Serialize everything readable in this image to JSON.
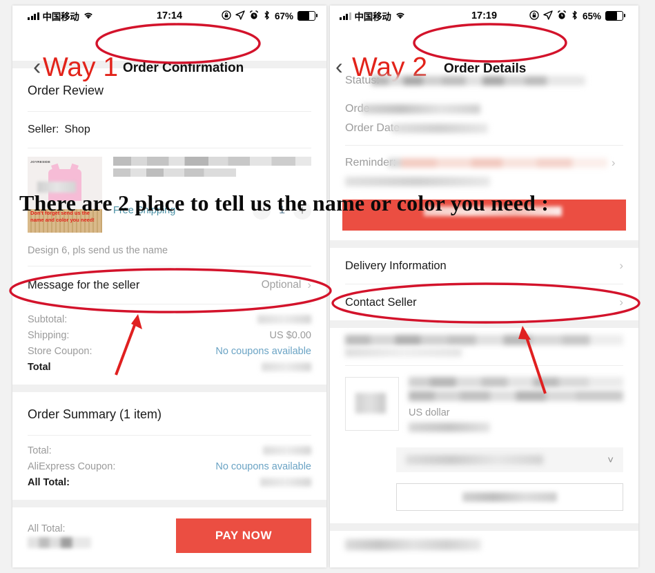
{
  "annotation": {
    "headline": "There are 2 place to tell us the name or color you need :",
    "way1_label": "Way 1",
    "way2_label": "Way 2",
    "circle_color": "#d3132b",
    "arrow_color": "#e02020"
  },
  "left_phone": {
    "status_bar": {
      "carrier": "中国移动",
      "time": "17:14",
      "battery_percent": "67%",
      "icons": [
        "signal-bars-icon",
        "wifi-icon",
        "rotation-lock-icon",
        "location-arrow-icon",
        "alarm-clock-icon",
        "bluetooth-icon",
        "battery-icon"
      ]
    },
    "nav": {
      "back_icon": "chevron-left-icon",
      "title": "Order Confirmation"
    },
    "order_review": {
      "section_title": "Order Review",
      "seller_label": "Seller:",
      "seller_name": "Shop",
      "product_thumb_brand": "JOYRESIDE",
      "product_thumb_caption_line1": "Don't forget send us the",
      "product_thumb_caption_line2": "name and color you need!",
      "free_shipping": "Free Shipping",
      "qty_minus": "−",
      "qty_value": "1",
      "qty_plus": "+",
      "design_note": "Design 6, pls send us the name"
    },
    "message_row": {
      "label": "Message for the seller",
      "value": "Optional",
      "chevron": "chevron-right-icon"
    },
    "totals": [
      {
        "label": "Subtotal:",
        "value": "",
        "blurred": true
      },
      {
        "label": "Shipping:",
        "value": "US $0.00",
        "blurred": false
      },
      {
        "label": "Store Coupon:",
        "value": "No coupons available",
        "link": true
      },
      {
        "label": "Total",
        "value": "",
        "blurred": true,
        "bold": true
      }
    ],
    "order_summary": {
      "title": "Order Summary (1 item)",
      "rows": [
        {
          "label": "Total:",
          "value": "",
          "blurred": true
        },
        {
          "label": "AliExpress Coupon:",
          "value": "No coupons available",
          "link": true
        },
        {
          "label": "All Total:",
          "value": "",
          "blurred": true,
          "bold": true
        }
      ]
    },
    "pay_bar": {
      "all_total_label": "All Total:",
      "amount": "",
      "pay_button": "PAY NOW",
      "pay_button_color": "#eb4e42"
    }
  },
  "right_phone": {
    "status_bar": {
      "carrier": "中国移动",
      "time": "17:19",
      "battery_percent": "65%",
      "icons": [
        "signal-bars-icon",
        "wifi-icon",
        "rotation-lock-icon",
        "location-arrow-icon",
        "alarm-clock-icon",
        "bluetooth-icon",
        "battery-icon"
      ]
    },
    "nav": {
      "back_icon": "chevron-left-icon",
      "title": "Order Details"
    },
    "status_block": [
      {
        "label": "Status:",
        "value": "",
        "blurred": true
      },
      {
        "label": "Orde",
        "value": "",
        "blurred": true
      },
      {
        "label": "Order Date",
        "value": "",
        "blurred": true
      }
    ],
    "reminder": {
      "label": "Reminder:",
      "value": "",
      "blurred": true
    },
    "links": [
      {
        "label": "Delivery Information",
        "chevron": "chevron-right-icon"
      },
      {
        "label": "Contact Seller",
        "chevron": "chevron-right-icon"
      }
    ],
    "item": {
      "currency_note": "US dollar",
      "select_caret": "chevron-down-icon"
    }
  },
  "chart_data": null
}
